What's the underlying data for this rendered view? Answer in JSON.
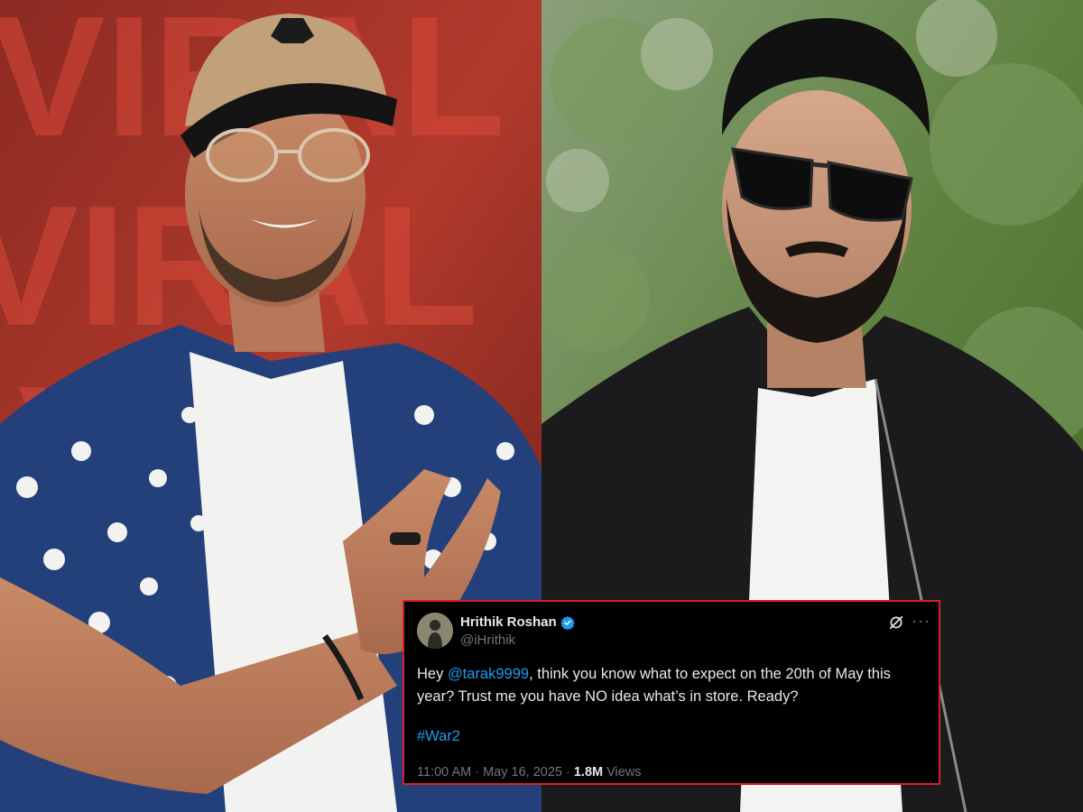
{
  "tweet": {
    "display_name": "Hrithik Roshan",
    "handle": "@iHrithik",
    "body_prefix": "Hey ",
    "mention": "@tarak9999",
    "body_suffix": ", think you know what to expect on the 20th of May this year? Trust me you have NO idea what’s in store. Ready?",
    "hashtag": "#War2",
    "time": "11:00 AM",
    "separator": " · ",
    "date": "May 16, 2025",
    "views_count": "1.8M",
    "views_label": " Views",
    "icons": [
      "verified-badge-icon",
      "grok-icon",
      "more-options-icon"
    ]
  },
  "colors": {
    "card_border": "#d7202a",
    "link": "#1d9bf0",
    "verified": "#1d9bf0",
    "secondary_text": "#71767b"
  },
  "left_photo_backdrop_text": "VIRAL"
}
